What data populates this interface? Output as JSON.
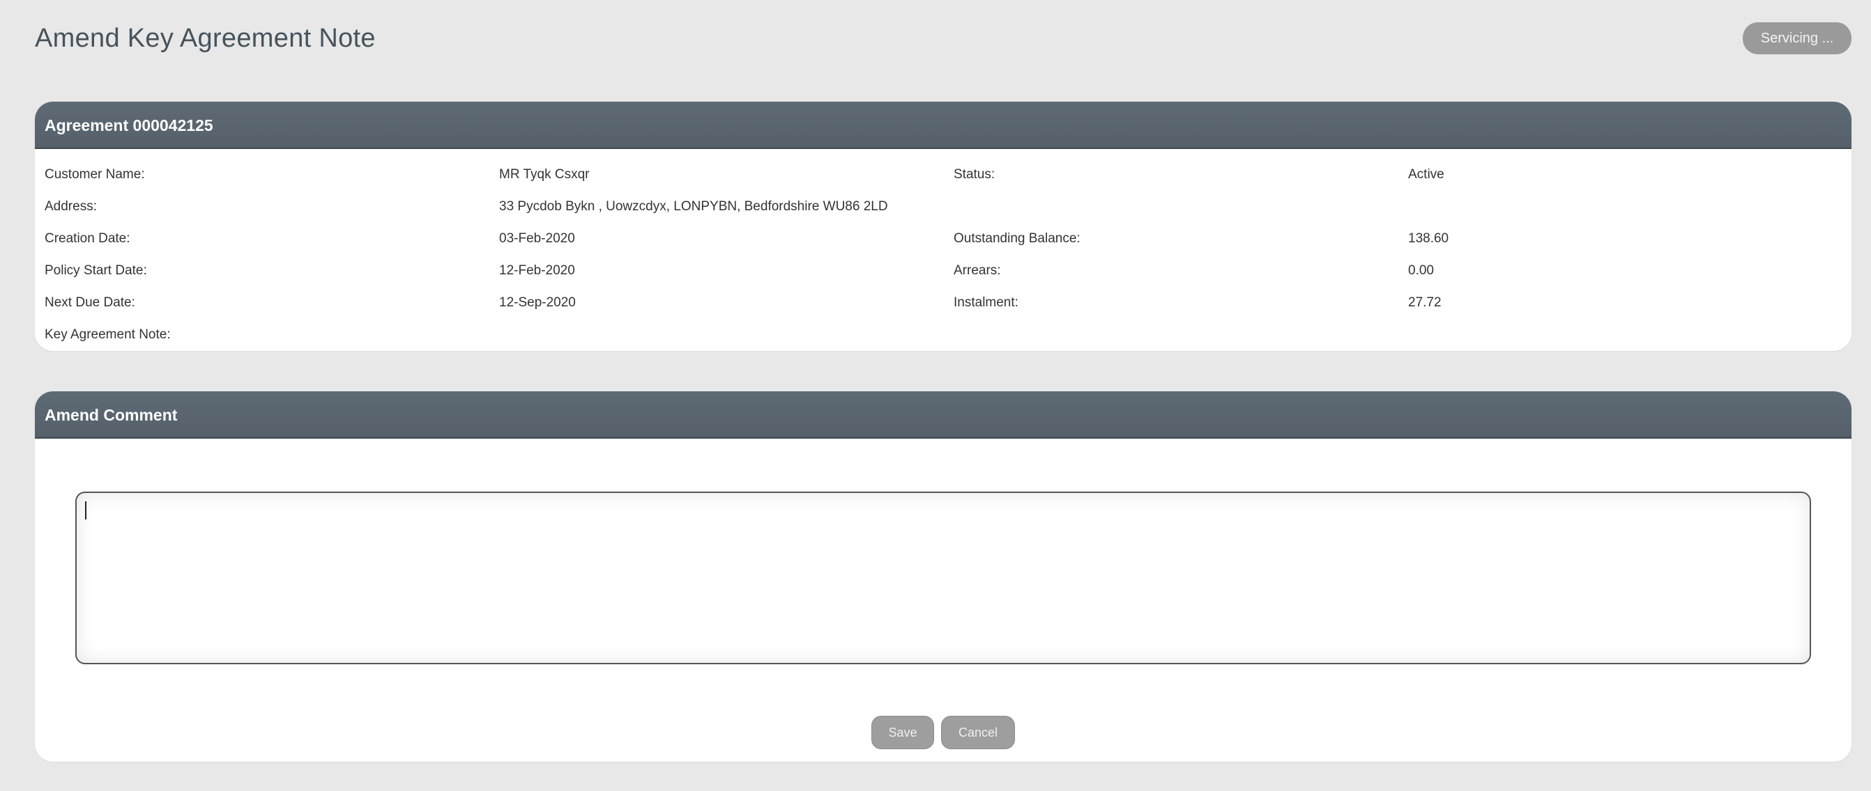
{
  "page": {
    "title": "Amend Key Agreement Note",
    "servicing_label": "Servicing ..."
  },
  "agreement": {
    "header": "Agreement 000042125",
    "rows": [
      {
        "label1": "Customer Name:",
        "value1": "MR Tyqk Csxqr",
        "label2": "Status:",
        "value2": "Active"
      },
      {
        "label1": "Address:",
        "value1": "33 Pycdob Bykn , Uowzcdyx, LONPYBN, Bedfordshire WU86 2LD",
        "label2": "",
        "value2": ""
      },
      {
        "label1": "Creation Date:",
        "value1": "03-Feb-2020",
        "label2": "Outstanding Balance:",
        "value2": "138.60"
      },
      {
        "label1": "Policy Start Date:",
        "value1": "12-Feb-2020",
        "label2": "Arrears:",
        "value2": "0.00"
      },
      {
        "label1": "Next Due Date:",
        "value1": "12-Sep-2020",
        "label2": "Instalment:",
        "value2": "27.72"
      },
      {
        "label1": "Key Agreement Note:",
        "value1": "",
        "label2": "",
        "value2": ""
      }
    ]
  },
  "comment": {
    "header": "Amend Comment",
    "value": "",
    "save_label": "Save",
    "cancel_label": "Cancel"
  },
  "colors": {
    "header_bg": "#5a6670",
    "page_bg": "#e8e8e8",
    "button_bg": "#9e9e9e"
  }
}
